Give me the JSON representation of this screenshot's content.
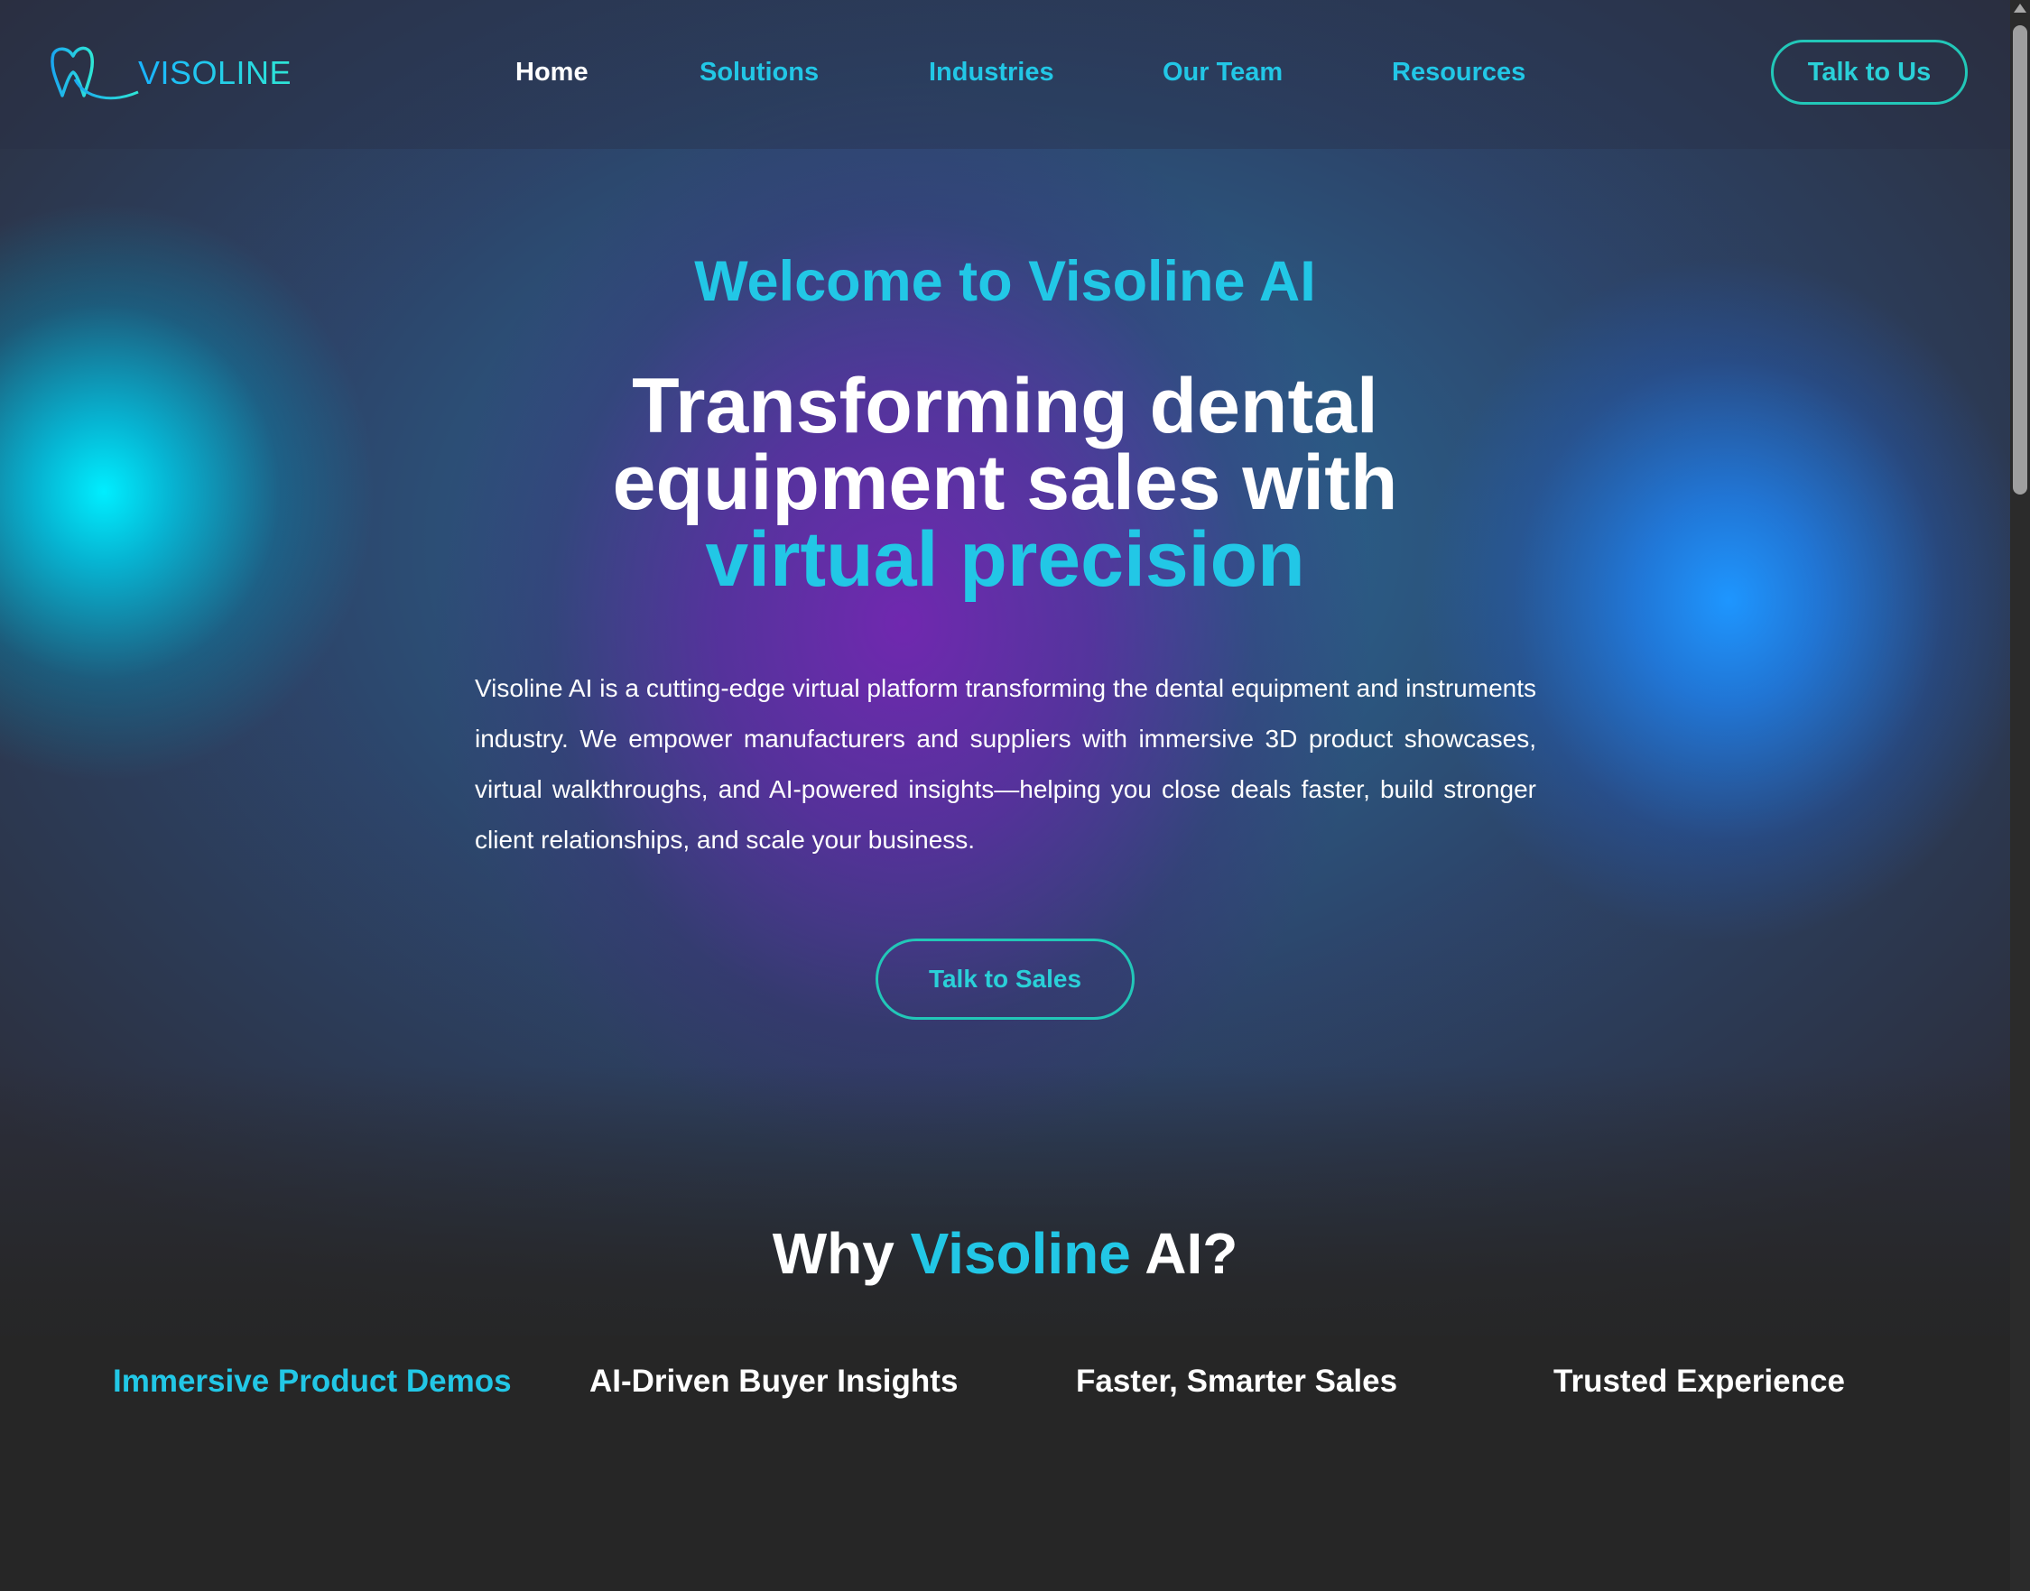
{
  "brand": {
    "logo_text": "VISOLINE"
  },
  "nav": {
    "items": [
      {
        "label": "Home",
        "active": true
      },
      {
        "label": "Solutions",
        "active": false
      },
      {
        "label": "Industries",
        "active": false
      },
      {
        "label": "Our Team",
        "active": false
      },
      {
        "label": "Resources",
        "active": false
      }
    ],
    "cta_label": "Talk to Us"
  },
  "hero": {
    "welcome": "Welcome to Visoline AI",
    "headline_line1": "Transforming dental",
    "headline_line2": "equipment sales with",
    "headline_accent": "virtual precision",
    "intro": "Visoline AI is a cutting-edge virtual platform transforming the dental equipment and instruments industry. We empower manufacturers and suppliers with immersive 3D product showcases, virtual walkthroughs, and AI-powered insights—helping you close deals faster, build stronger client relationships, and scale your business.",
    "cta_label": "Talk to Sales"
  },
  "why": {
    "prefix": "Why ",
    "accent": "Visoline",
    "suffix": " AI?",
    "tabs": [
      {
        "label": "Immersive Product Demos",
        "active": true
      },
      {
        "label": "AI-Driven Buyer Insights",
        "active": false
      },
      {
        "label": "Faster, Smarter Sales",
        "active": false
      },
      {
        "label": "Trusted Experience",
        "active": false
      }
    ]
  },
  "colors": {
    "accent": "#22c7e6",
    "button_border": "#22c7b8",
    "page_background": "#262626",
    "glow_left": "#00eeff",
    "glow_right": "#1e96ff",
    "glow_center": "#7028af"
  },
  "icons": {
    "logo_mark": "tooth-logo-icon"
  }
}
